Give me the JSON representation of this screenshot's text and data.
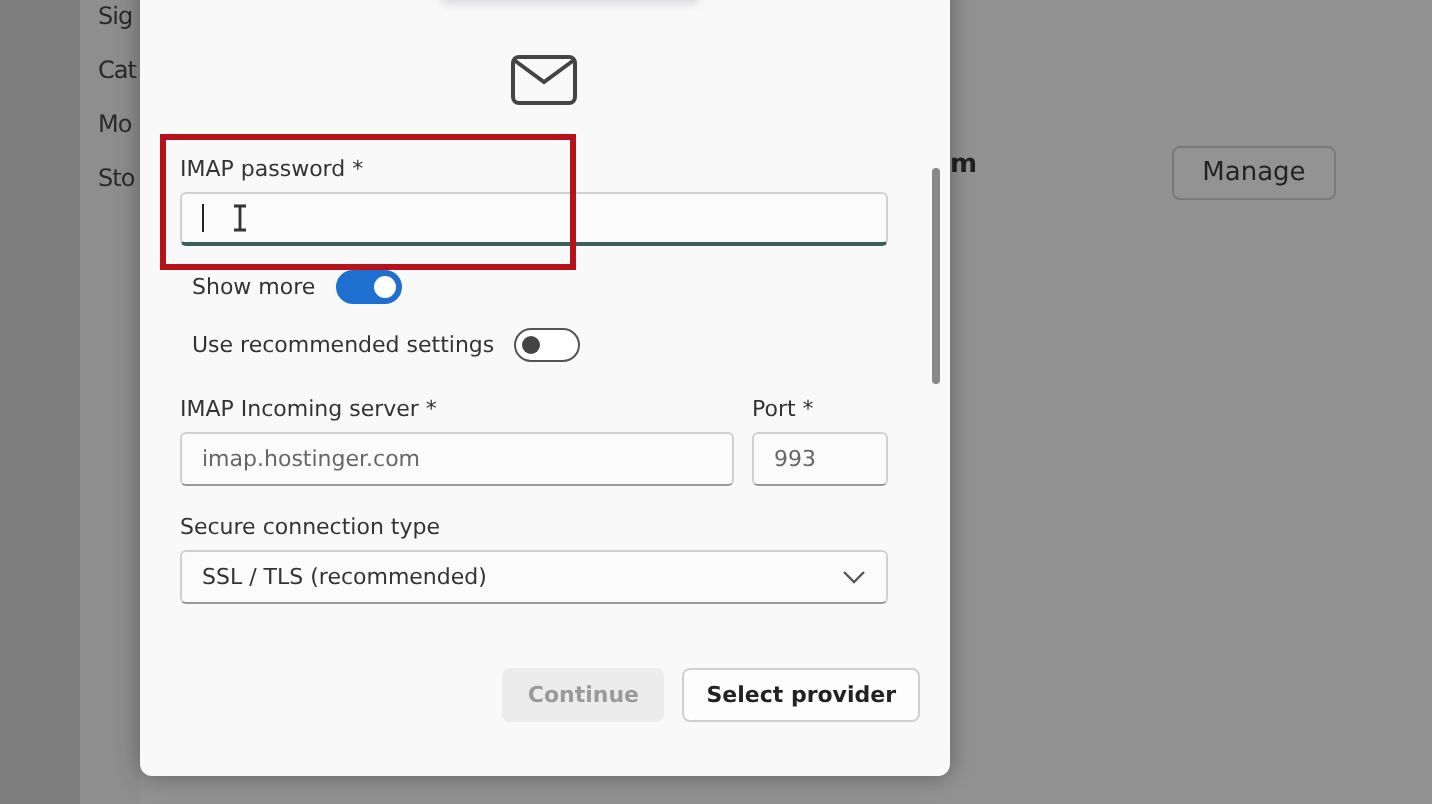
{
  "background": {
    "labels": [
      "Sig",
      "Cat",
      "Mo",
      "Sto"
    ],
    "heading_fragment": "m",
    "manage_button": "Manage"
  },
  "dialog": {
    "password": {
      "label": "IMAP password *",
      "focused": true
    },
    "toggles": [
      {
        "label": "Show more",
        "on": true
      },
      {
        "label": "Use recommended settings",
        "on": false
      }
    ],
    "server": {
      "label": "IMAP Incoming server *",
      "value": "imap.hostinger.com"
    },
    "port": {
      "label": "Port *",
      "value": "993"
    },
    "connection": {
      "label": "Secure connection type",
      "value": "SSL / TLS (recommended)"
    },
    "buttons": [
      {
        "label": "Continue",
        "disabled": true
      },
      {
        "label": "Select provider",
        "disabled": false
      }
    ]
  }
}
